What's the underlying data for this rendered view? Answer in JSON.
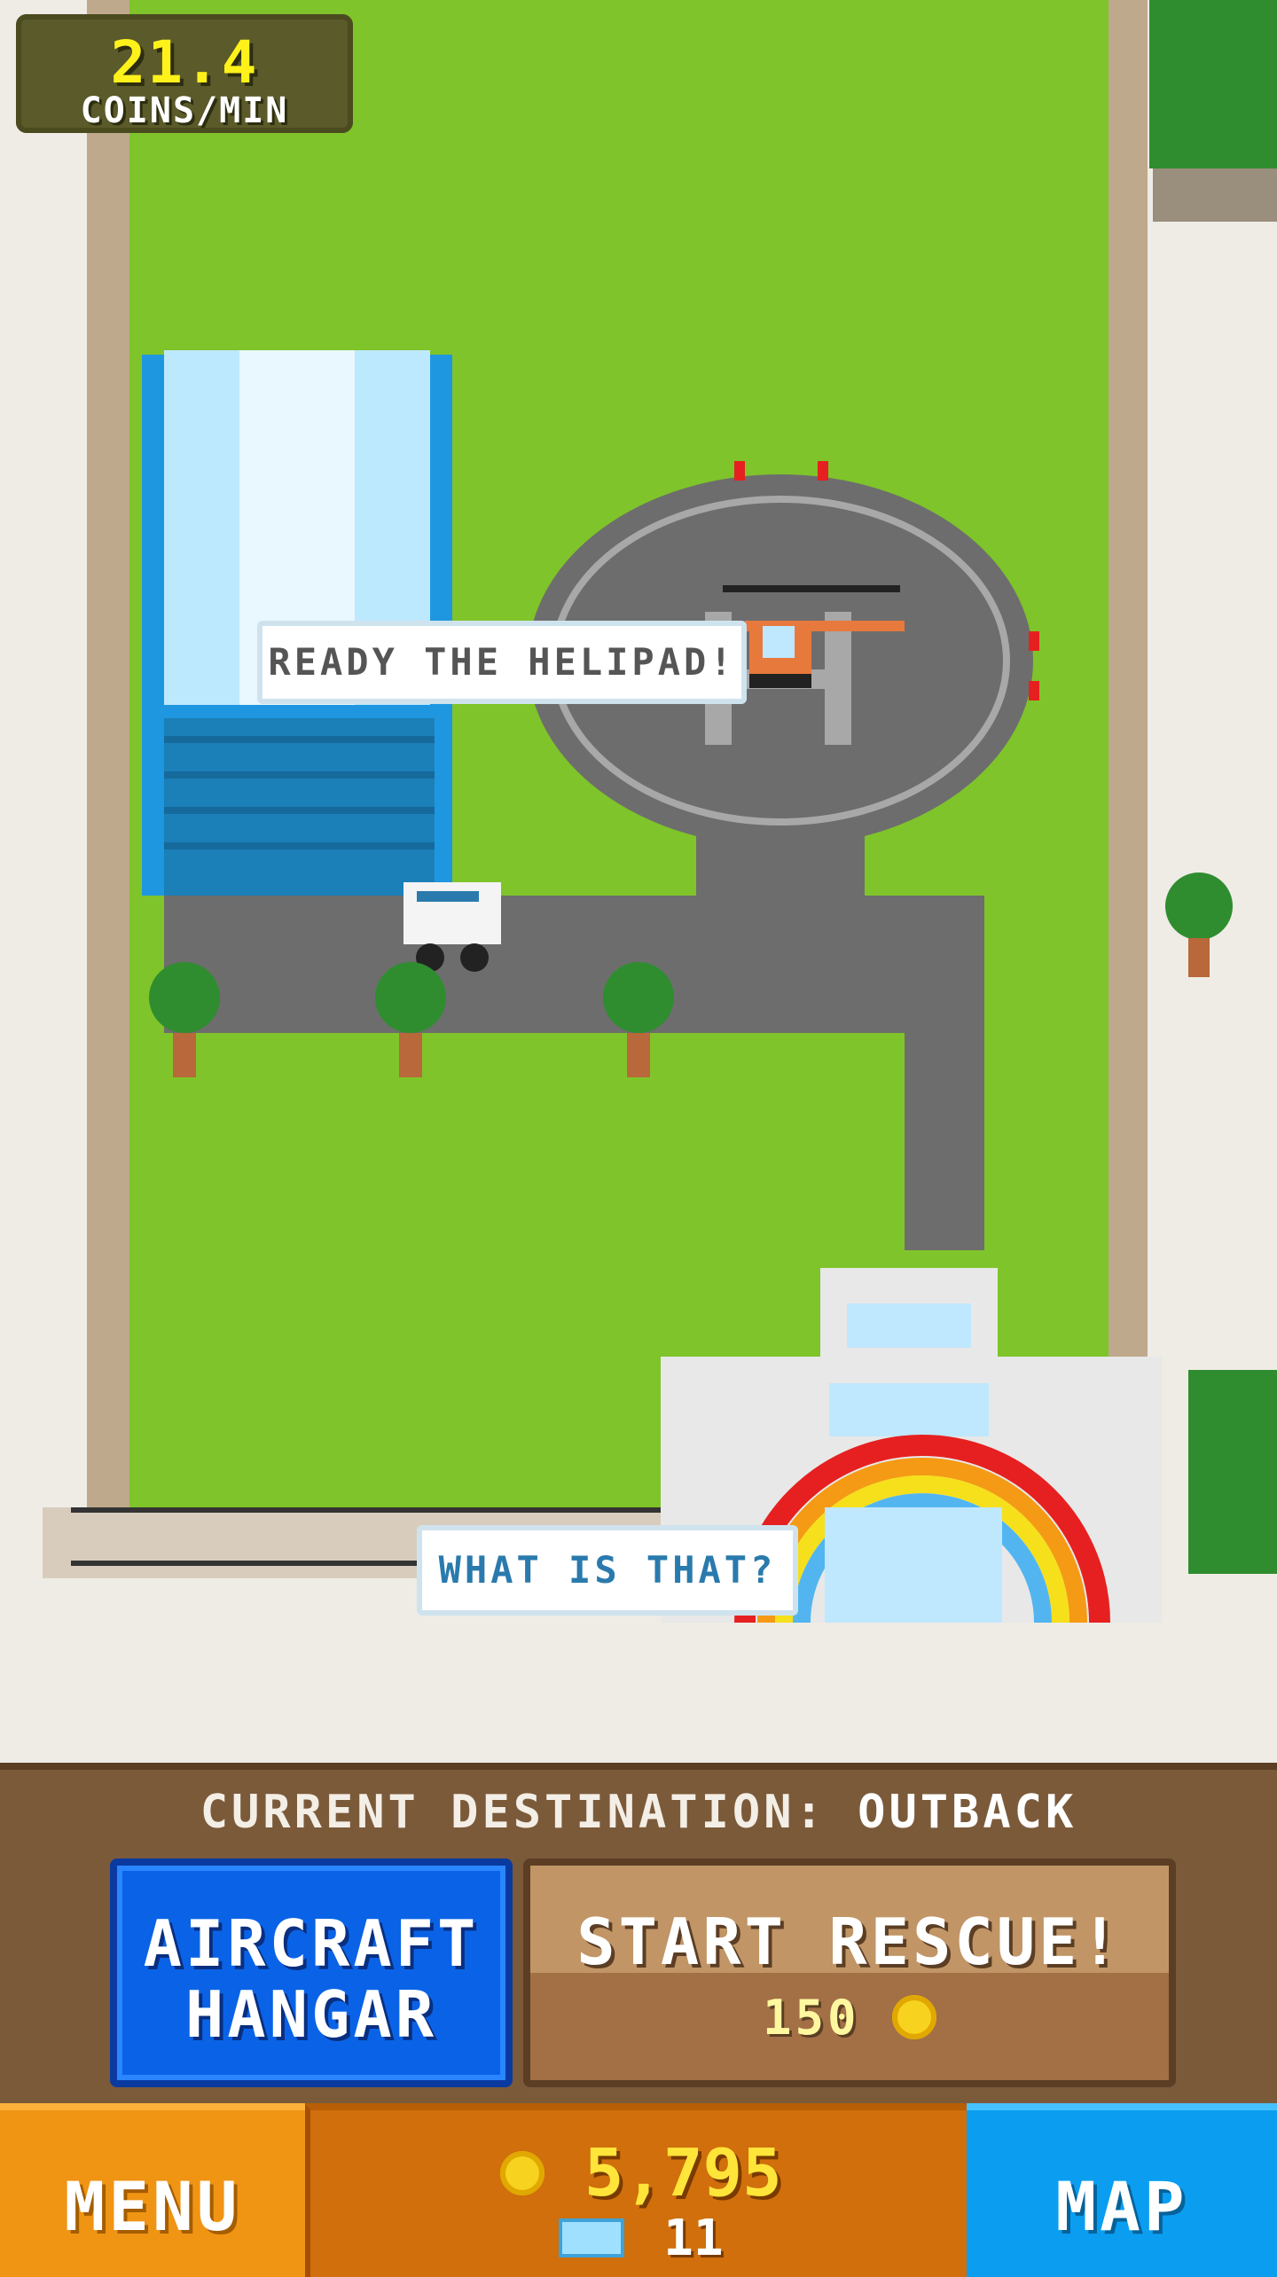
{
  "hud": {
    "rate_value": "21.4",
    "rate_unit": "COINS/MIN"
  },
  "bubbles": {
    "helipad": "READY THE HELIPAD!",
    "what": "WHAT IS THAT?"
  },
  "panel": {
    "dest_label": "CURRENT DESTINATION:",
    "dest_value": "OUTBACK",
    "hangar_line1": "AIRCRAFT",
    "hangar_line2": "HANGAR",
    "rescue_label": "START RESCUE!",
    "rescue_cost": "150"
  },
  "bottom_bar": {
    "menu_label": "MENU",
    "coins": "5,795",
    "gems": "11",
    "map_label": "MAP"
  },
  "colors": {
    "grass": "#7fc42a",
    "road": "#6d6d6d",
    "coin_text": "#ffe53a",
    "hangar_button": "#0a63e6",
    "map_button": "#0b9ef0",
    "menu_button": "#f09414"
  },
  "icons": [
    "coin-icon",
    "gem-icon",
    "helicopter",
    "fire-icon"
  ]
}
